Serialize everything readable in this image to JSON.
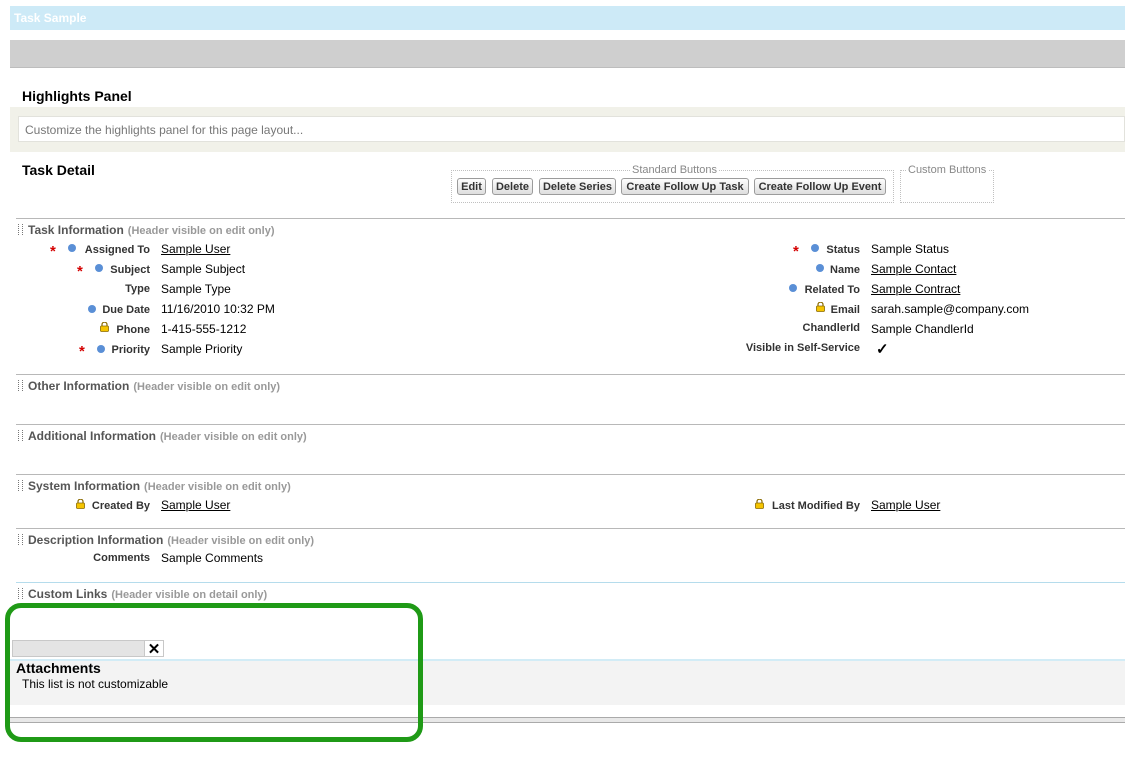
{
  "window": {
    "title": "Task Sample"
  },
  "highlights": {
    "title": "Highlights Panel",
    "placeholder": "Customize the highlights panel for this page layout..."
  },
  "detail": {
    "title": "Task Detail",
    "standard_buttons_legend": "Standard Buttons",
    "custom_buttons_legend": "Custom Buttons",
    "buttons": [
      "Edit",
      "Delete",
      "Delete Series",
      "Create Follow Up Task",
      "Create Follow Up Event"
    ]
  },
  "sections": {
    "task": {
      "title": "Task Information",
      "note": "(Header visible on edit only)"
    },
    "other": {
      "title": "Other Information",
      "note": "(Header visible on edit only)"
    },
    "additional": {
      "title": "Additional Information",
      "note": "(Header visible on edit only)"
    },
    "system": {
      "title": "System Information",
      "note": "(Header visible on edit only)"
    },
    "description": {
      "title": "Description Information",
      "note": "(Header visible on edit only)"
    },
    "custom_links": {
      "title": "Custom Links",
      "note": "(Header visible on detail only)"
    }
  },
  "fields": {
    "assigned_to": {
      "label": "Assigned To",
      "value": "Sample User"
    },
    "subject": {
      "label": "Subject",
      "value": "Sample Subject"
    },
    "type": {
      "label": "Type",
      "value": "Sample Type"
    },
    "due_date": {
      "label": "Due Date",
      "value": "11/16/2010 10:32 PM"
    },
    "phone": {
      "label": "Phone",
      "value": "1-415-555-1212"
    },
    "priority": {
      "label": "Priority",
      "value": "Sample Priority"
    },
    "status": {
      "label": "Status",
      "value": "Sample Status"
    },
    "name": {
      "label": "Name",
      "value": "Sample Contact"
    },
    "related_to": {
      "label": "Related To",
      "value": "Sample Contract"
    },
    "email": {
      "label": "Email",
      "value": "sarah.sample@company.com"
    },
    "chandler_id": {
      "label": "ChandlerId",
      "value": "Sample ChandlerId"
    },
    "visible_self_service": {
      "label": "Visible in Self-Service",
      "value": "✓"
    },
    "created_by": {
      "label": "Created By",
      "value": "Sample User"
    },
    "last_modified_by": {
      "label": "Last Modified By",
      "value": "Sample User"
    },
    "comments": {
      "label": "Comments",
      "value": "Sample Comments"
    }
  },
  "attachments": {
    "title": "Attachments",
    "note": "This list is not customizable",
    "close_glyph": "✕"
  },
  "colors": {
    "title_bar": "#cdeaf7",
    "required": "#d40000",
    "indicator_dot": "#5a8fd6",
    "highlight_outline": "#1f9a16"
  }
}
